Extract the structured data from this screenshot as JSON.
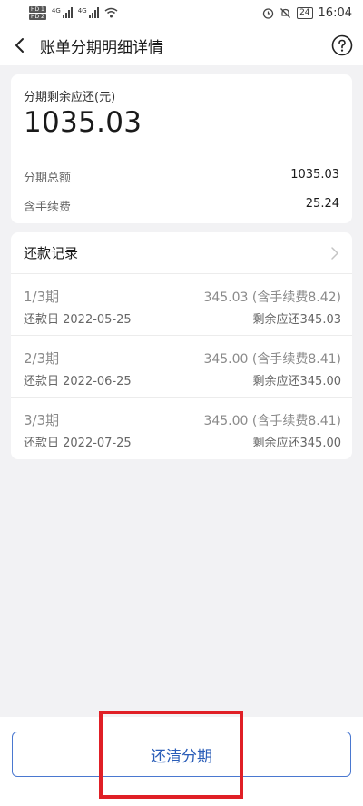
{
  "status_bar": {
    "hd1": "HD 1",
    "hd2": "HD 2",
    "net1": "4G",
    "net2": "4G",
    "battery": "24",
    "time": "16:04"
  },
  "header": {
    "title": "账单分期明细详情"
  },
  "summary": {
    "remain_label": "分期剩余应还(元)",
    "remain_value": "1035.03",
    "total_label": "分期总额",
    "total_value": "1035.03",
    "fee_label": "含手续费",
    "fee_value": "25.24"
  },
  "records": {
    "title": "还款记录",
    "items": [
      {
        "period": "1/3期",
        "amount": "345.03 (含手续费8.42)",
        "date": "还款日 2022-05-25",
        "remain": "剩余应还345.03"
      },
      {
        "period": "2/3期",
        "amount": "345.00 (含手续费8.41)",
        "date": "还款日 2022-06-25",
        "remain": "剩余应还345.00"
      },
      {
        "period": "3/3期",
        "amount": "345.00 (含手续费8.41)",
        "date": "还款日 2022-07-25",
        "remain": "剩余应还345.00"
      }
    ]
  },
  "bottom": {
    "payoff_label": "还清分期"
  },
  "colors": {
    "accent_blue": "#2a5db8",
    "highlight_red": "#e01f26"
  }
}
